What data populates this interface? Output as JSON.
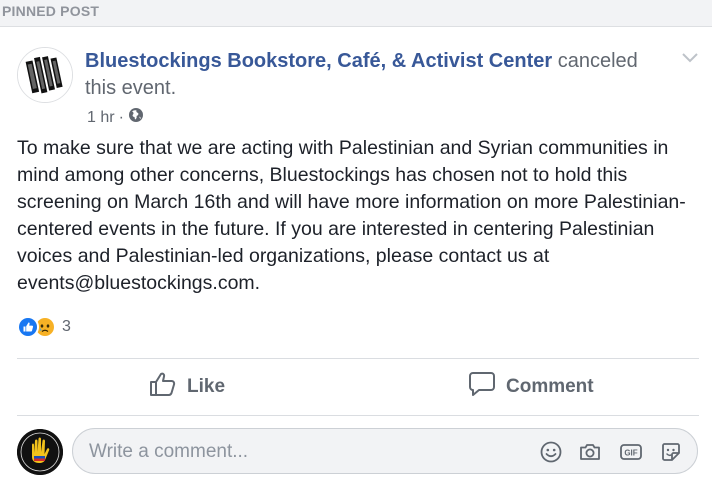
{
  "pinned_label": "PINNED POST",
  "post": {
    "page_name": "Bluestockings Bookstore, Café, & Activist Center",
    "action": "canceled this event.",
    "time": "1 hr",
    "separator": "·",
    "privacy_icon": "globe-icon",
    "body": "To make sure that we are acting with Palestinian and Syrian communities in mind among other concerns, Bluestockings has chosen not to hold this screening on March 16th and will have more information on more Palestinian-centered events in the future. If you are interested in centering Palestinian voices and Palestinian-led organizations, please contact us at events@bluestockings.com.",
    "reactions": {
      "icons": [
        "like-reaction-icon",
        "sad-reaction-icon"
      ],
      "count": "3"
    },
    "actions": {
      "like_label": "Like",
      "comment_label": "Comment"
    }
  },
  "comment_composer": {
    "placeholder": "Write a comment...",
    "icons": [
      "emoji-icon",
      "camera-icon",
      "gif-icon",
      "sticker-icon"
    ]
  },
  "colors": {
    "link_blue": "#385898",
    "like_blue": "#1877f2",
    "sad_yellow": "#f7b125",
    "muted_gray": "#616770"
  }
}
